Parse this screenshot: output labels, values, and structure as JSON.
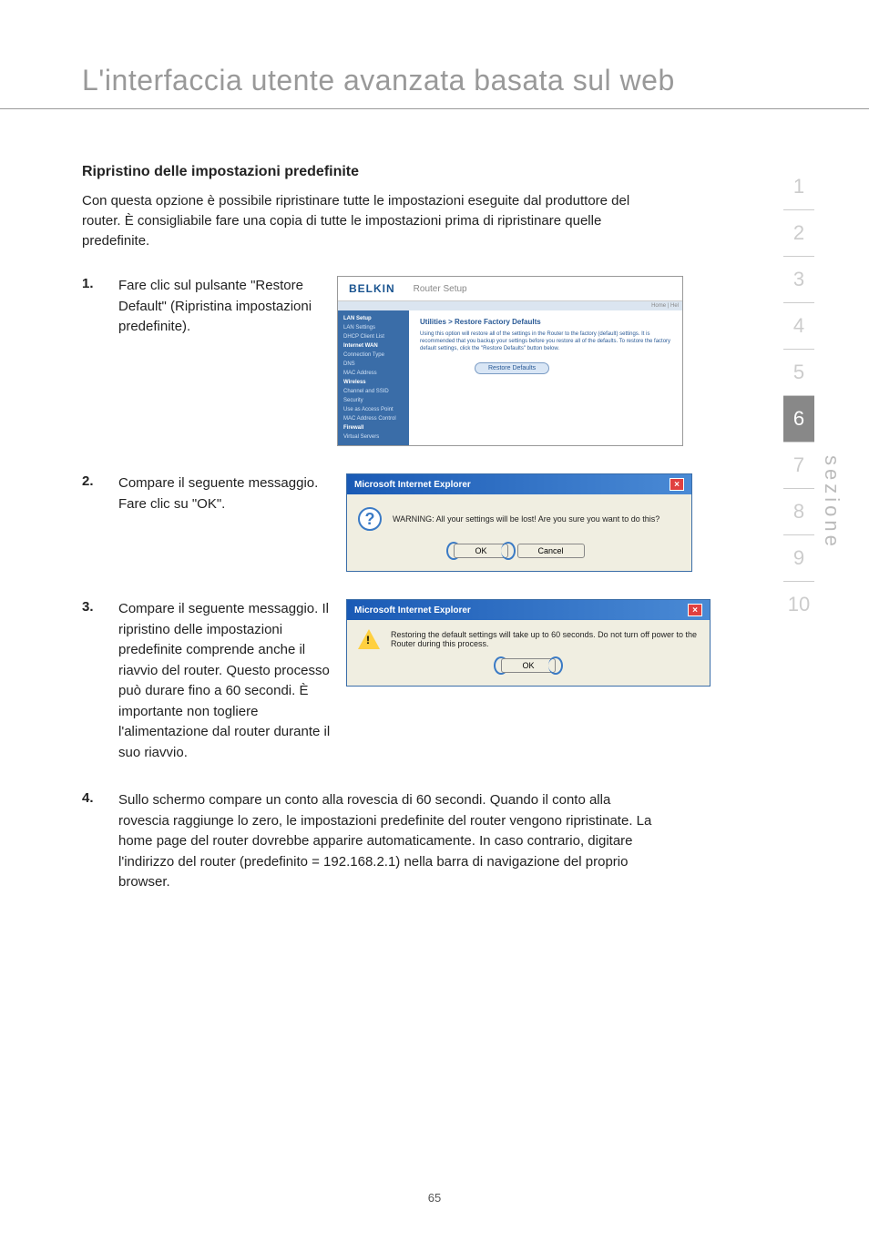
{
  "page": {
    "title": "L'interfaccia utente avanzata basata sul web",
    "number": "65"
  },
  "section": {
    "heading": "Ripristino delle impostazioni predefinite",
    "intro": "Con questa opzione è possibile ripristinare tutte le impostazioni eseguite dal produttore del router. È consigliabile fare una copia di tutte le impostazioni prima di ripristinare quelle predefinite."
  },
  "steps": [
    {
      "num": "1.",
      "text": "   Fare clic sul pulsante \"Restore Default\" (Ripristina impostazioni predefinite)."
    },
    {
      "num": "2.",
      "text": "Compare il seguente messaggio. Fare clic su \"OK\"."
    },
    {
      "num": "3.",
      "text": "Compare il seguente messaggio. Il ripristino delle impostazioni predefinite comprende anche il riavvio del router. Questo processo può durare fino a 60 secondi. È importante non togliere l'alimentazione dal router durante il suo riavvio."
    },
    {
      "num": "4.",
      "text": "Sullo schermo compare un conto alla rovescia di 60 secondi. Quando il conto alla rovescia raggiunge lo zero, le impostazioni predefinite del router vengono ripristinate. La home page del router dovrebbe apparire automaticamente. In caso contrario, digitare l'indirizzo del router (predefinito = 192.168.2.1) nella barra di navigazione del proprio browser."
    }
  ],
  "router": {
    "logo": "BELKIN",
    "setup": "Router Setup",
    "home_help": "Home | Hel",
    "sidebar": {
      "lan_setup": "LAN Setup",
      "lan_settings": "LAN Settings",
      "dhcp": "DHCP Client List",
      "wan": "Internet WAN",
      "conn_type": "Connection Type",
      "dns": "DNS",
      "mac": "MAC Address",
      "wireless": "Wireless",
      "channel": "Channel and SSID",
      "security": "Security",
      "ap": "Use as Access Point",
      "mac_ctrl": "MAC Address Control",
      "firewall": "Firewall",
      "vservers": "Virtual Servers"
    },
    "main_title": "Utilities > Restore Factory Defaults",
    "main_text": "Using this option will restore all of the settings in the Router to the factory (default) settings. It is recommended that you backup your settings before you restore all of the defaults. To restore the factory default settings, click the \"Restore Defaults\" button below.",
    "restore_btn": "Restore Defaults"
  },
  "dialog1": {
    "title": "Microsoft Internet Explorer",
    "message": "WARNING: All your settings will be lost! Are you sure you want to do this?",
    "ok": "OK",
    "cancel": "Cancel"
  },
  "dialog2": {
    "title": "Microsoft Internet Explorer",
    "message": "Restoring the default settings will take up to 60 seconds. Do not turn off power to the Router during this process.",
    "ok": "OK"
  },
  "tabs": [
    "1",
    "2",
    "3",
    "4",
    "5",
    "6",
    "7",
    "8",
    "9",
    "10"
  ],
  "side_label": "sezione"
}
